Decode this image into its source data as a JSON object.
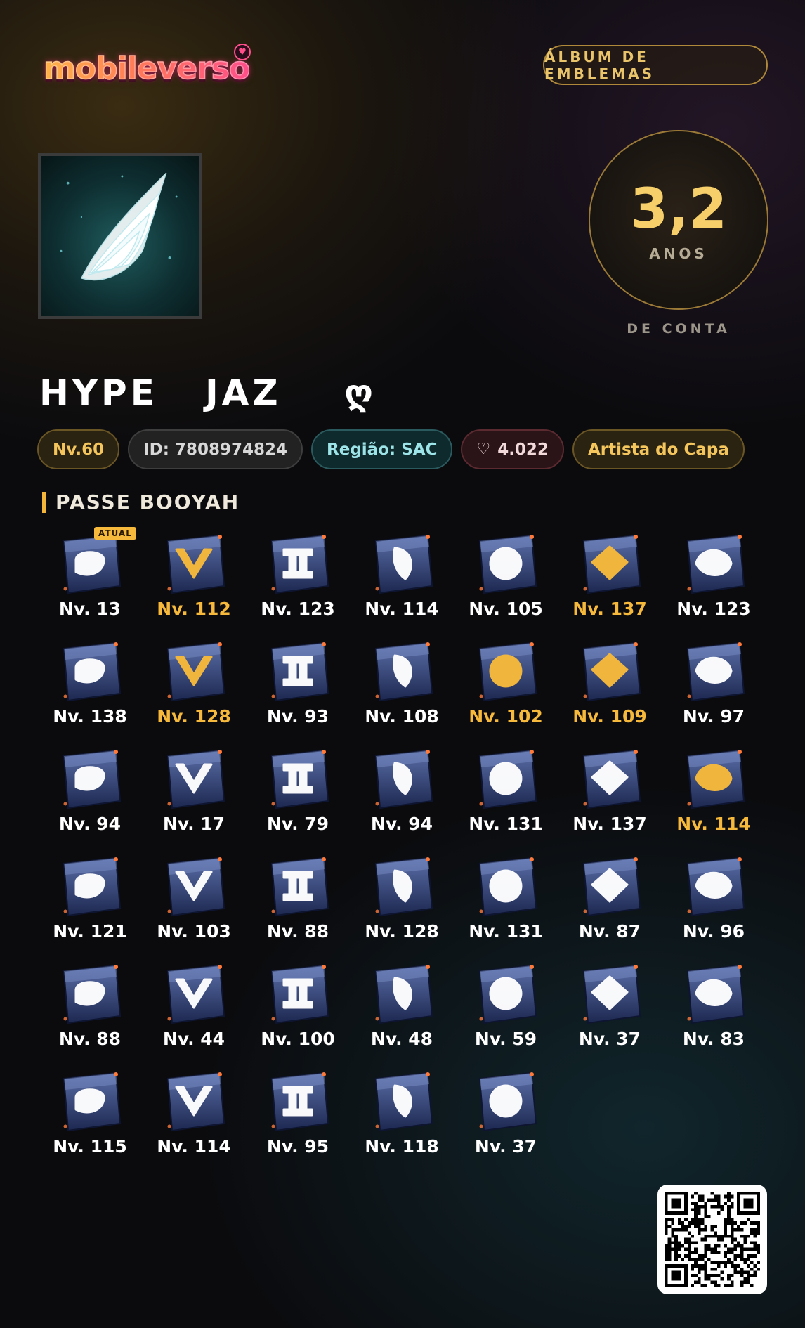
{
  "header": {
    "logo_text": "mobileverso",
    "album_button": "ÁLBUM DE EMBLEMAS"
  },
  "account": {
    "years_value": "3,2",
    "years_unit": "ANOS",
    "account_label": "DE CONTA"
  },
  "profile": {
    "name": "HYPE   JAZ    ღ",
    "avatar_icon": "angel-wing-icon",
    "chips": {
      "level": "Nv.60",
      "id": "ID: 7808974824",
      "region": "Região: SAC",
      "likes": "4.022",
      "title": "Artista do Capa"
    }
  },
  "badges_section": {
    "title": "PASSE BOOYAH",
    "current_tag": "ATUAL",
    "colors": {
      "gold": "#f6b93b",
      "white": "#ffffff"
    },
    "items": [
      {
        "level": "Nv. 13",
        "gold": false,
        "current": true
      },
      {
        "level": "Nv. 112",
        "gold": true
      },
      {
        "level": "Nv. 123",
        "gold": false
      },
      {
        "level": "Nv. 114",
        "gold": false
      },
      {
        "level": "Nv. 105",
        "gold": false
      },
      {
        "level": "Nv. 137",
        "gold": true
      },
      {
        "level": "Nv. 123",
        "gold": false
      },
      {
        "level": "Nv. 138",
        "gold": false
      },
      {
        "level": "Nv. 128",
        "gold": true
      },
      {
        "level": "Nv. 93",
        "gold": false
      },
      {
        "level": "Nv. 108",
        "gold": false
      },
      {
        "level": "Nv. 102",
        "gold": true
      },
      {
        "level": "Nv. 109",
        "gold": true
      },
      {
        "level": "Nv. 97",
        "gold": false
      },
      {
        "level": "Nv. 94",
        "gold": false
      },
      {
        "level": "Nv. 17",
        "gold": false
      },
      {
        "level": "Nv. 79",
        "gold": false
      },
      {
        "level": "Nv. 94",
        "gold": false
      },
      {
        "level": "Nv. 131",
        "gold": false
      },
      {
        "level": "Nv. 137",
        "gold": false
      },
      {
        "level": "Nv. 114",
        "gold": true
      },
      {
        "level": "Nv. 121",
        "gold": false
      },
      {
        "level": "Nv. 103",
        "gold": false
      },
      {
        "level": "Nv. 88",
        "gold": false
      },
      {
        "level": "Nv. 128",
        "gold": false
      },
      {
        "level": "Nv. 131",
        "gold": false
      },
      {
        "level": "Nv. 87",
        "gold": false
      },
      {
        "level": "Nv. 96",
        "gold": false
      },
      {
        "level": "Nv. 88",
        "gold": false
      },
      {
        "level": "Nv. 44",
        "gold": false
      },
      {
        "level": "Nv. 100",
        "gold": false
      },
      {
        "level": "Nv. 48",
        "gold": false
      },
      {
        "level": "Nv. 59",
        "gold": false
      },
      {
        "level": "Nv. 37",
        "gold": false
      },
      {
        "level": "Nv. 83",
        "gold": false
      },
      {
        "level": "Nv. 115",
        "gold": false
      },
      {
        "level": "Nv. 114",
        "gold": false
      },
      {
        "level": "Nv. 95",
        "gold": false
      },
      {
        "level": "Nv. 118",
        "gold": false
      },
      {
        "level": "Nv. 37",
        "gold": false
      }
    ]
  },
  "footer": {
    "qr_icon": "qr-code-icon"
  }
}
